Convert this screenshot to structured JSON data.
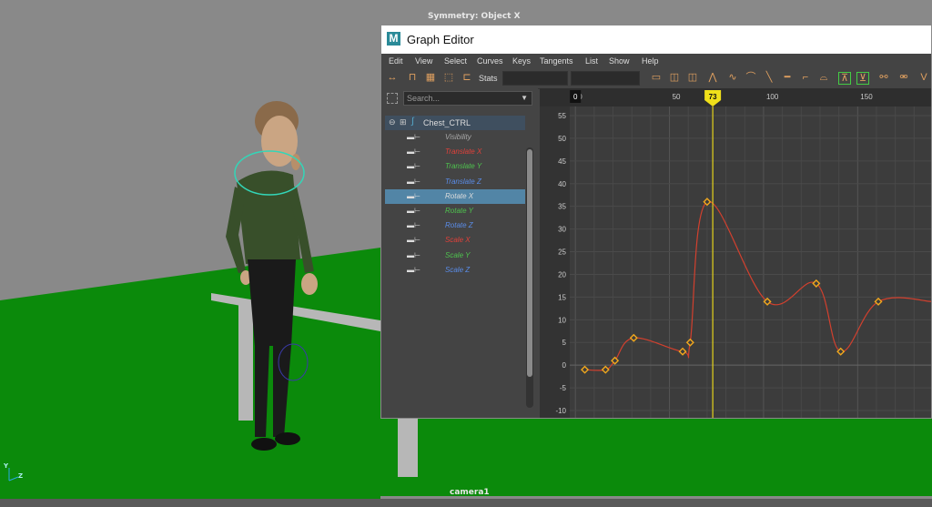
{
  "viewport": {
    "top_label": "Symmetry: Object X",
    "camera_label": "camera1",
    "axis_label_y": "Y",
    "axis_label_z": "Z",
    "colors": {
      "sky": "#8a8a8a",
      "floor": "#0b8a0b"
    }
  },
  "graph_editor": {
    "title": "Graph Editor",
    "logo": "M",
    "menu": [
      "Edit",
      "View",
      "Select",
      "Curves",
      "Keys",
      "Tangents",
      "List",
      "Show",
      "Help"
    ],
    "toolbar": {
      "stats_label": "Stats"
    },
    "search_placeholder": "Search...",
    "tree_root": "Chest_CTRL",
    "attributes": [
      {
        "label": "Visibility",
        "color": "#a8a8a8",
        "selected": false
      },
      {
        "label": "Translate X",
        "color": "#e0413a",
        "selected": false
      },
      {
        "label": "Translate Y",
        "color": "#4ec24e",
        "selected": false
      },
      {
        "label": "Translate Z",
        "color": "#5a8ce8",
        "selected": false
      },
      {
        "label": "Rotate X",
        "color": "#dcdcdc",
        "selected": true
      },
      {
        "label": "Rotate Y",
        "color": "#4ec24e",
        "selected": false
      },
      {
        "label": "Rotate Z",
        "color": "#5a8ce8",
        "selected": false
      },
      {
        "label": "Scale X",
        "color": "#e0413a",
        "selected": false
      },
      {
        "label": "Scale Y",
        "color": "#4ec24e",
        "selected": false
      },
      {
        "label": "Scale Z",
        "color": "#5a8ce8",
        "selected": false
      }
    ],
    "current_frame": "73",
    "frame_ticks": [
      "0",
      "50",
      "100",
      "150"
    ],
    "value_ticks": [
      "55",
      "50",
      "45",
      "40",
      "35",
      "30",
      "25",
      "20",
      "15",
      "10",
      "5",
      "0",
      "-5",
      "-10"
    ]
  },
  "chart_data": {
    "type": "line",
    "title": "",
    "xlabel": "",
    "ylabel": "",
    "xlim": [
      -3,
      190
    ],
    "ylim": [
      -12,
      57
    ],
    "series": [
      {
        "name": "Rotate X",
        "color": "#d2402e",
        "keys_x": [
          5,
          16,
          21,
          31,
          57,
          61,
          70,
          102,
          128,
          141,
          161,
          190
        ],
        "keys_y": [
          -1,
          -1,
          1,
          6,
          3,
          5,
          36,
          14,
          18,
          3,
          14,
          14
        ]
      }
    ]
  }
}
